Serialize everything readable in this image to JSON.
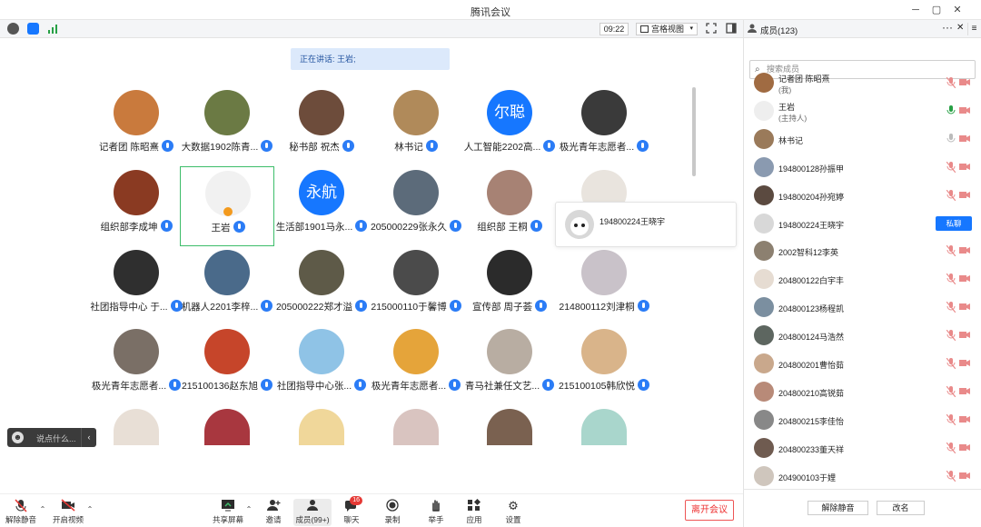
{
  "window": {
    "title": "腾讯会议",
    "controls": [
      "─",
      "▢",
      "✕"
    ]
  },
  "topbar": {
    "time": "09:22",
    "view_label": "宫格视图",
    "view_caret": "▾"
  },
  "speaking": {
    "label": "正在讲话: 王岩;"
  },
  "colors": {
    "accent": "#1677ff",
    "active_border": "#3dbd6a",
    "danger": "#e53935"
  },
  "grid": {
    "participants": [
      {
        "name": "记者团 陈昭熹",
        "avatar": "photo"
      },
      {
        "name": "大数据1902陈青...",
        "avatar": "photo"
      },
      {
        "name": "秘书部 祝杰",
        "avatar": "photo"
      },
      {
        "name": "林书记",
        "avatar": "photo"
      },
      {
        "name": "人工智能2202高...",
        "avatar_text": "尔聪"
      },
      {
        "name": "极光青年志愿者...",
        "avatar": "photo"
      },
      {
        "name": "组织部李成坤",
        "avatar": "photo"
      },
      {
        "name": "王岩",
        "avatar": "photo",
        "active": true
      },
      {
        "name": "生活部1901马永...",
        "avatar_text": "永航"
      },
      {
        "name": "205000229张永久",
        "avatar": "photo"
      },
      {
        "name": "组织部 王桐",
        "avatar": "photo"
      },
      {
        "name": "",
        "avatar": "photo"
      },
      {
        "name": "社团指导中心 于...",
        "avatar": "photo"
      },
      {
        "name": "机器人2201李梓...",
        "avatar": "photo"
      },
      {
        "name": "205000222郑才溢",
        "avatar": "photo"
      },
      {
        "name": "215000110于馨博",
        "avatar": "photo"
      },
      {
        "name": "宣传部 周子荟",
        "avatar": "photo"
      },
      {
        "name": "214800112刘津桐",
        "avatar": "photo"
      },
      {
        "name": "极光青年志愿者...",
        "avatar": "photo"
      },
      {
        "name": "215100136赵东旭",
        "avatar": "photo"
      },
      {
        "name": "社团指导中心张...",
        "avatar": "photo"
      },
      {
        "name": "极光青年志愿者...",
        "avatar": "photo"
      },
      {
        "name": "青马社兼任文艺...",
        "avatar": "photo"
      },
      {
        "name": "215100105韩欣悦",
        "avatar": "photo"
      }
    ]
  },
  "popcard": {
    "name": "194800224王晓宇"
  },
  "chat_input": {
    "placeholder": "说点什么...",
    "emoji": "☻",
    "collapse": "‹"
  },
  "toolbar": {
    "mute": "解除静音",
    "video": "开启视频",
    "share": "共享屏幕",
    "invite": "邀请",
    "members": "成员(99+)",
    "chat": "聊天",
    "chat_badge": "16",
    "record": "录制",
    "raise_hand": "举手",
    "apps": "应用",
    "settings": "设置",
    "leave": "离开会议"
  },
  "panel": {
    "title": "成员(123)",
    "search_placeholder": "搜索成员",
    "members": [
      {
        "name": "记者团 陈昭熹",
        "sub": "(我)"
      },
      {
        "name": "王岩",
        "sub": "(主持人)",
        "mic_on": true
      },
      {
        "name": "林书记",
        "mic_off_grey": true
      },
      {
        "name": "194800128孙振甲"
      },
      {
        "name": "194800204孙宛婷"
      },
      {
        "name": "194800224王晓宇",
        "chat_button": "私聊"
      },
      {
        "name": "2002智科12李英"
      },
      {
        "name": "204800122白宇丰"
      },
      {
        "name": "204800123杨程凯"
      },
      {
        "name": "204800124马浩然"
      },
      {
        "name": "204800201曹怡茹"
      },
      {
        "name": "204800210高锐茹"
      },
      {
        "name": "204800215李佳怡"
      },
      {
        "name": "204800233董天祥"
      },
      {
        "name": "204900103于娌"
      }
    ],
    "footer": {
      "unmute_all": "解除静音",
      "rename": "改名"
    }
  }
}
